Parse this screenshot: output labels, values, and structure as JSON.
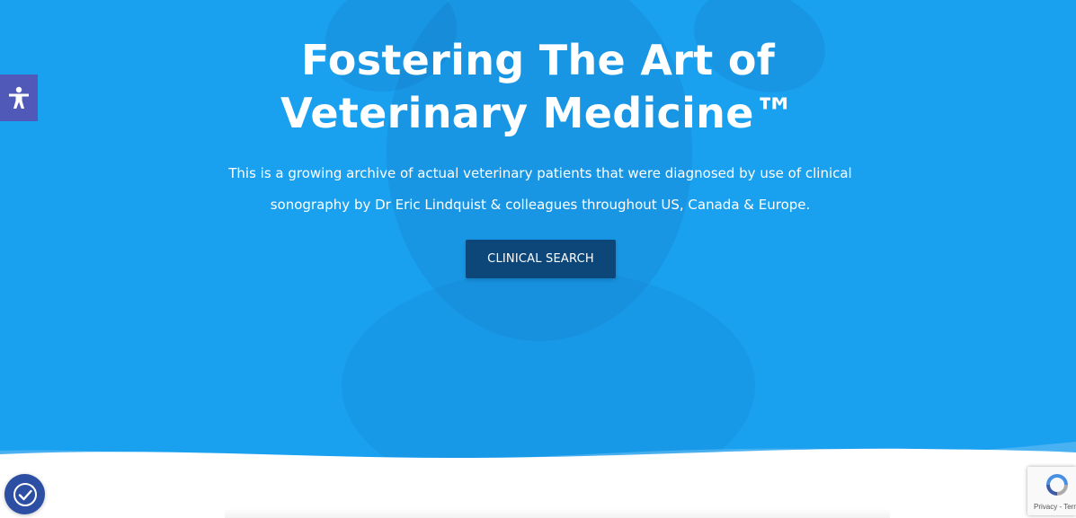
{
  "hero": {
    "title_line1": "Fostering The Art of",
    "title_line2": "Veterinary Medicine™",
    "subtitle": "This is a growing archive of actual veterinary patients that were diagnosed by use of clinical sonography by Dr Eric Lindquist & colleagues throughout US, Canada & Europe.",
    "cta_label": "CLINICAL SEARCH"
  },
  "widgets": {
    "accessibility_icon": "accessibility-person-icon",
    "cookie_icon": "cookie-consent-icon",
    "recaptcha_text": "Privacy - Terms"
  },
  "colors": {
    "hero_background": "#19a0ef",
    "cta_background": "#0d4779",
    "accessibility_background": "#5058b8",
    "cookie_background": "#2c4fa3"
  }
}
